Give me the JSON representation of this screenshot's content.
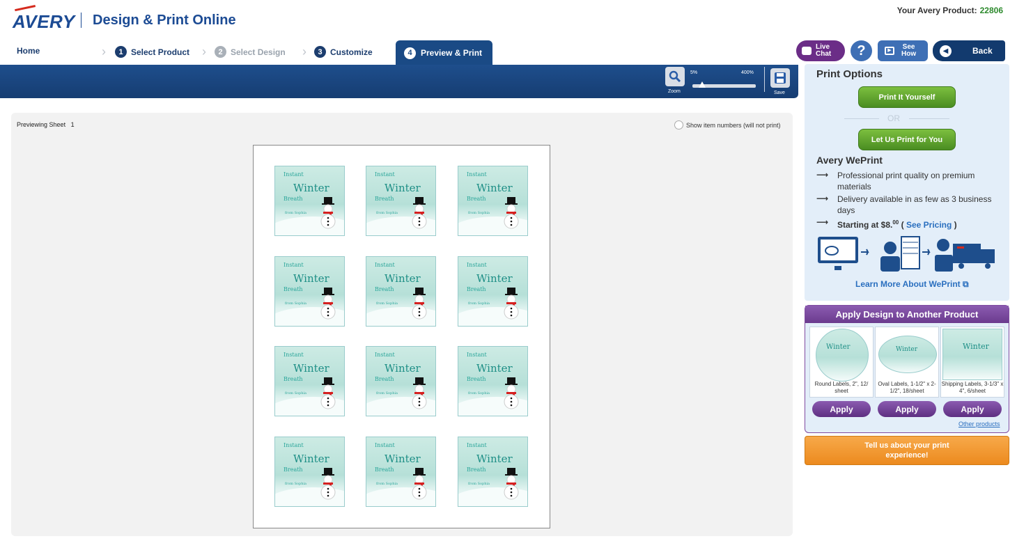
{
  "header": {
    "logo_text": "AVERY",
    "app_title": "Design & Print Online",
    "product_label": "Your Avery Product:",
    "product_number": "22806"
  },
  "steps": [
    {
      "label": "Home"
    },
    {
      "number": "1",
      "label": "Select Product"
    },
    {
      "number": "2",
      "label": "Select Design"
    },
    {
      "number": "3",
      "label": "Customize"
    },
    {
      "number": "4",
      "label": "Preview & Print"
    }
  ],
  "top_buttons": {
    "live_chat_1": "Live",
    "live_chat_2": "Chat",
    "help": "?",
    "see_how_1": "See",
    "see_how_2": "How",
    "back": "Back"
  },
  "toolbar": {
    "zoom_label": "Zoom",
    "zoom_min": "5%",
    "zoom_max": "400%",
    "zoom_level_fraction": 0.15,
    "save_label": "Save"
  },
  "preview": {
    "previewing_prefix": "Previewing",
    "sheet_label": "Sheet",
    "sheet_number": "1",
    "show_item_numbers": "Show item numbers (will not print)",
    "label_lines": [
      "Instant",
      "Winter",
      "Breath",
      "from Sophia"
    ],
    "label_count": 12
  },
  "print_options": {
    "title": "Print Options",
    "print_yourself": "Print It Yourself",
    "or": "OR",
    "let_us_print": "Let Us Print for You",
    "weprint_title": "Avery WePrint",
    "arrow": "⟶",
    "bullets": [
      "Professional print quality on premium materials",
      "Delivery available in as few as 3 business days"
    ],
    "pricing_prefix": "Starting at $8.",
    "pricing_cents": "00",
    "pricing_open": "(",
    "pricing_link": "See Pricing",
    "pricing_close": ")",
    "learn_more": "Learn More About WePrint"
  },
  "apply_design": {
    "title": "Apply Design to Another Product",
    "products": [
      {
        "name": "Round Labels, 2\", 12/ sheet"
      },
      {
        "name": "Oval Labels, 1-1/2\" x 2-1/2\", 18/sheet"
      },
      {
        "name": "Shipping Labels, 3-1/3\" x 4\", 6/sheet"
      }
    ],
    "apply_label": "Apply",
    "other_products": "Other products"
  },
  "feedback": {
    "line1": "Tell us about your print",
    "line2": "experience!"
  },
  "colors": {
    "brand_blue": "#1c4b94",
    "toolbar_blue": "#1a4a85",
    "purple": "#6b2d87",
    "green": "#5a9e2c",
    "orange": "#f29b32"
  }
}
